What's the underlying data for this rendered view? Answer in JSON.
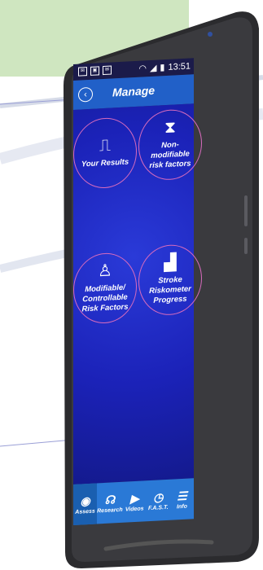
{
  "status": {
    "time": "13:51"
  },
  "header": {
    "title": "Manage"
  },
  "tiles": [
    {
      "label": "Your Results"
    },
    {
      "label": "Non-\nmodifiable\nrisk factors"
    },
    {
      "label": "Modifiable/\nControllable\nRisk Factors"
    },
    {
      "label": "Stroke\nRiskometer\nProgress"
    }
  ],
  "nav": [
    {
      "label": "Assess"
    },
    {
      "label": "Research"
    },
    {
      "label": "Videos"
    },
    {
      "label": "F.A.S.T."
    },
    {
      "label": "Info"
    }
  ],
  "colors": {
    "appbar": "#2160c8",
    "content": "#1b22b8",
    "navbar": "#2a79d6",
    "tile_border": "#d86bbd"
  }
}
